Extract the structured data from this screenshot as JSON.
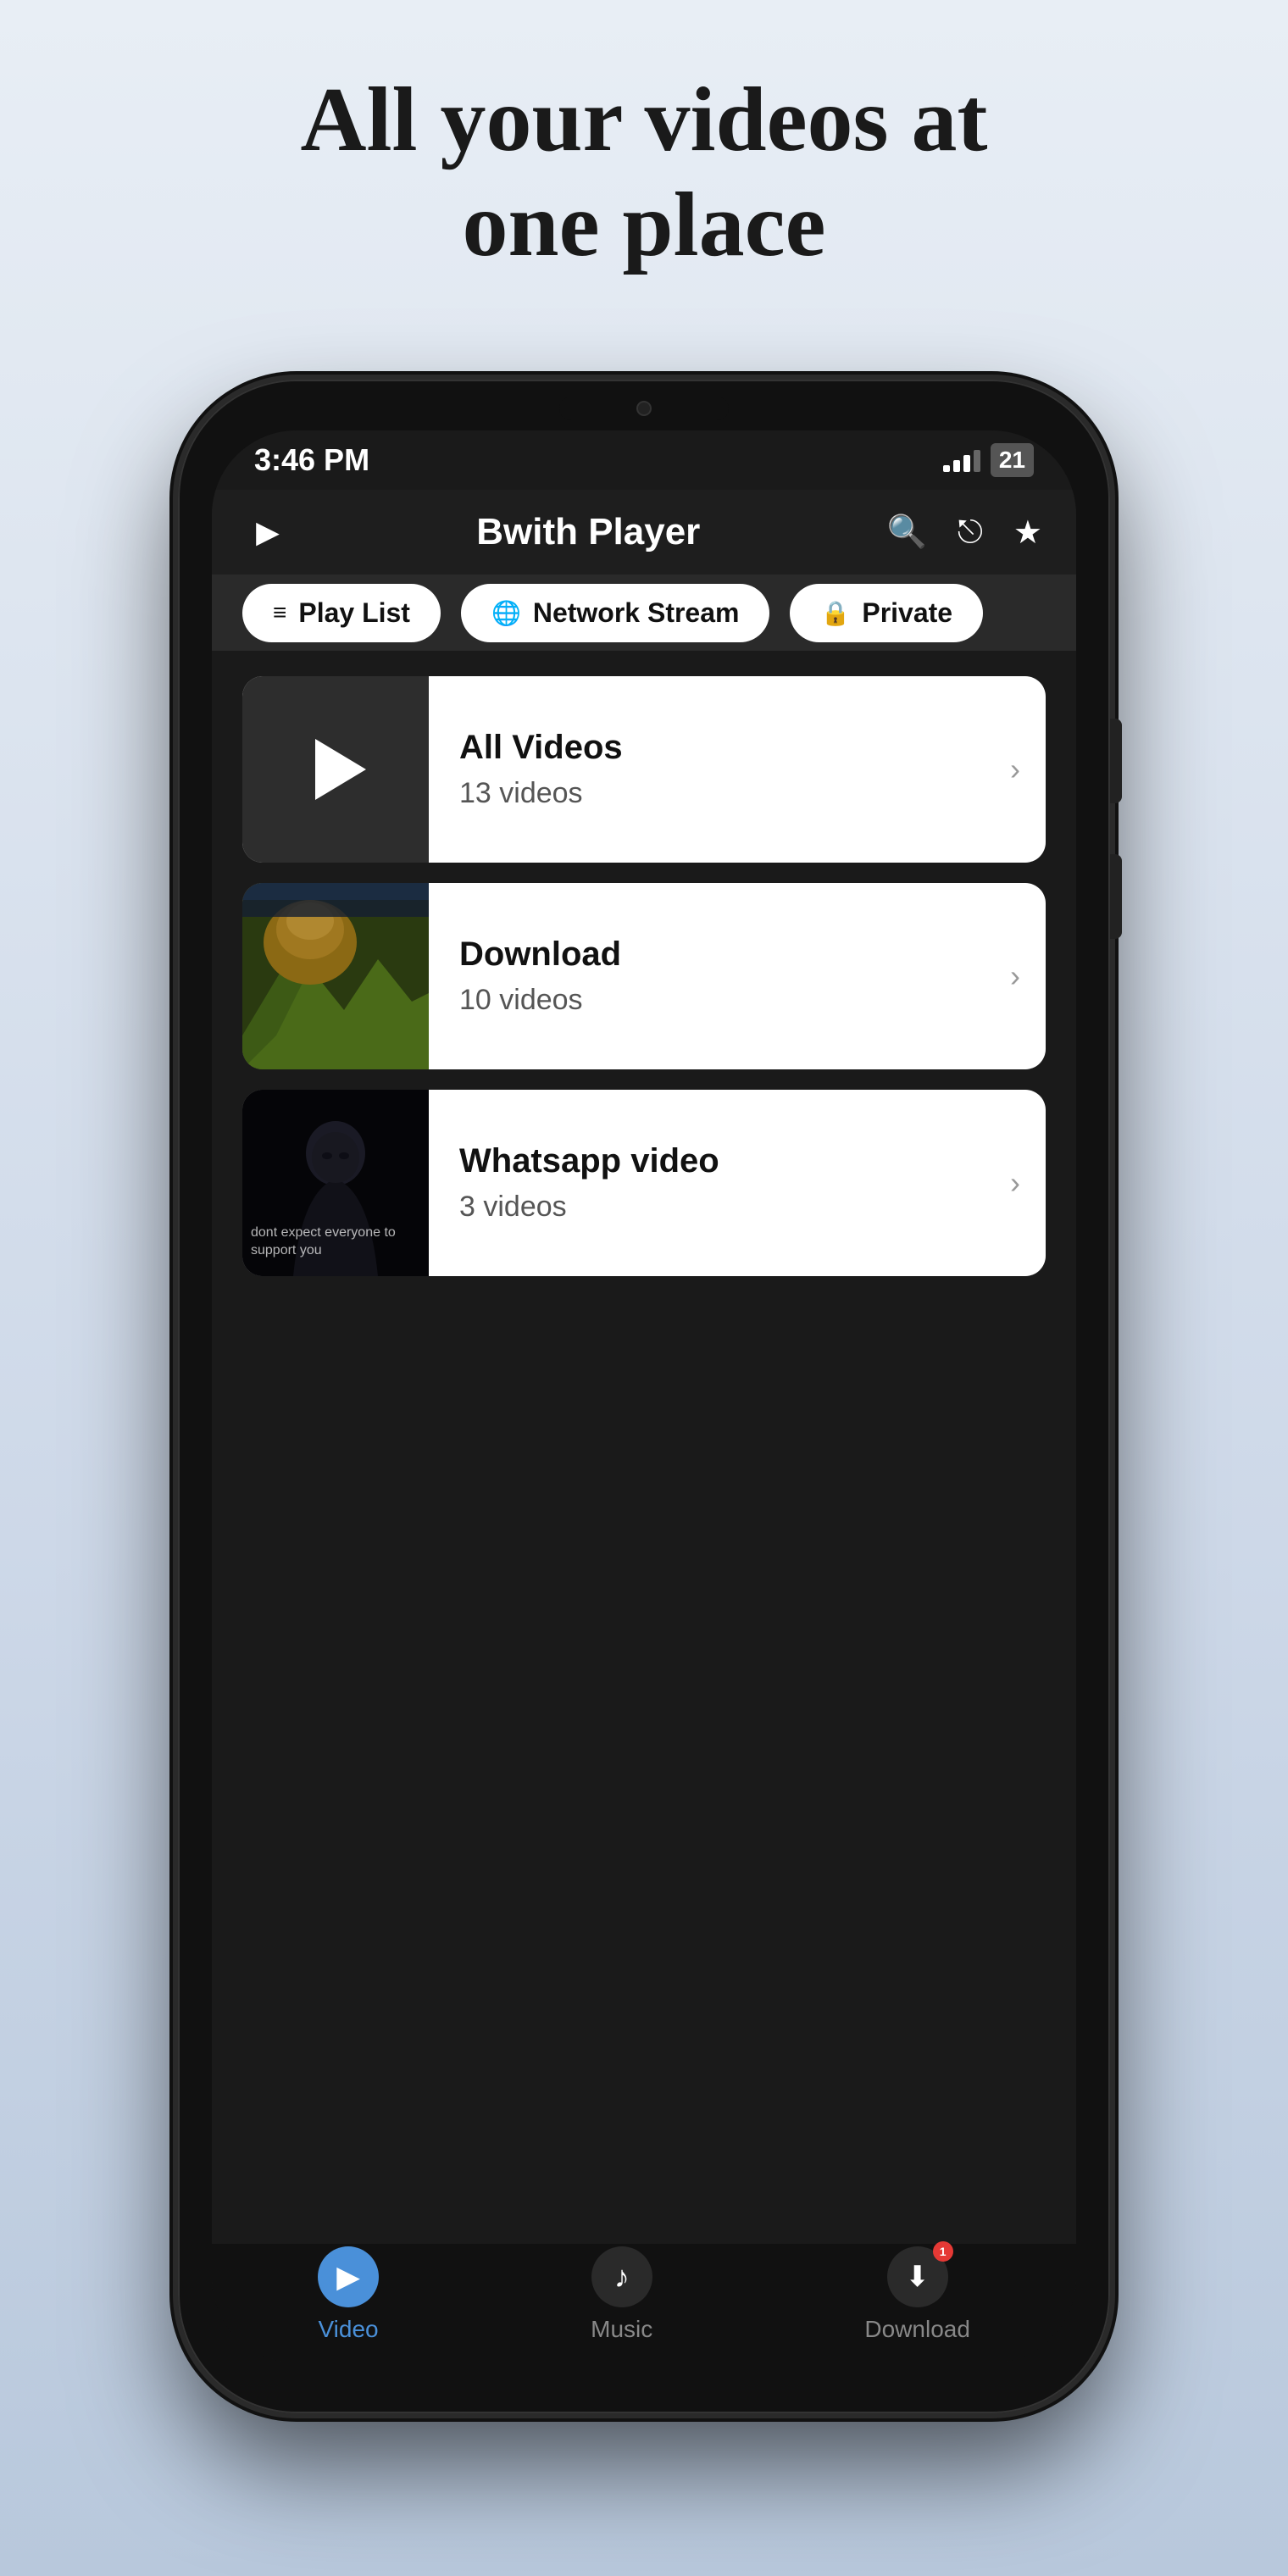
{
  "page": {
    "headline": "All your videos at one place",
    "background_color": "#e8eef5"
  },
  "status_bar": {
    "time": "3:46 PM",
    "battery": "21"
  },
  "app_header": {
    "title": "Bwith Player"
  },
  "tabs": [
    {
      "id": "playlist",
      "label": "Play List",
      "icon": "≡+"
    },
    {
      "id": "network",
      "label": "Network Stream",
      "icon": "🌐"
    },
    {
      "id": "private",
      "label": "Private",
      "icon": "🔒"
    }
  ],
  "folders": [
    {
      "id": "all-videos",
      "name": "All Videos",
      "count": "13 videos",
      "thumb_type": "dark"
    },
    {
      "id": "download",
      "name": "Download",
      "count": "10 videos",
      "thumb_type": "landscape"
    },
    {
      "id": "whatsapp",
      "name": "Whatsapp video",
      "count": "3 videos",
      "thumb_type": "person",
      "thumb_text": "dont expect everyone to support you"
    }
  ],
  "bottom_nav": [
    {
      "id": "video",
      "label": "Video",
      "active": true
    },
    {
      "id": "music",
      "label": "Music",
      "active": false
    },
    {
      "id": "download",
      "label": "Download",
      "active": false,
      "badge": "1"
    }
  ]
}
